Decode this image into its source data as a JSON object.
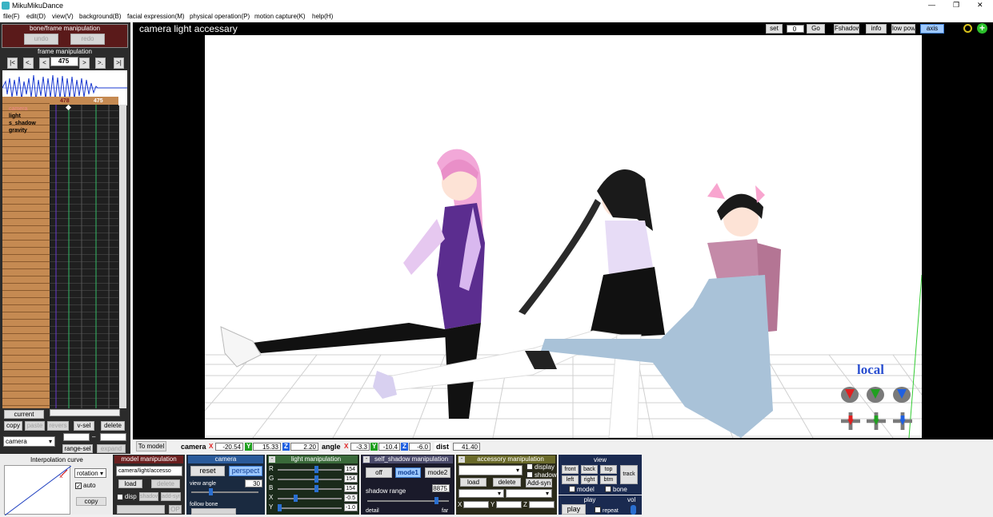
{
  "window": {
    "title": "MikuMikuDance",
    "minimize": "—",
    "restore": "❐",
    "close": "✕"
  },
  "menu": [
    "file(F)",
    "edit(D)",
    "view(V)",
    "background(B)",
    "facial expression(M)",
    "physical operation(P)",
    "motion capture(K)",
    "help(H)"
  ],
  "bone_frame": {
    "title": "bone/frame manipulation",
    "undo": "undo",
    "redo": "redo"
  },
  "frame_manip": {
    "title": "frame manipulation",
    "frame": "475",
    "nav": [
      "|<",
      "<.",
      "<",
      "> ",
      ">.",
      ">|"
    ]
  },
  "timeline": {
    "marker_a": "478",
    "marker_b": "475",
    "tracks": [
      "camera",
      "light",
      "s_shadow",
      "gravity"
    ]
  },
  "left_controls": {
    "current": "current",
    "copy": "copy",
    "paste": "paste",
    "revers": "revers",
    "v_sel": "v-sel",
    "delete": "delete",
    "range_sel": "range-sel",
    "expand": "expand",
    "target": "camera",
    "dash": "–"
  },
  "viewport": {
    "title": "camera light accessary",
    "set": "set",
    "set_value": "0",
    "go": "Go",
    "fshadow": "Fshadow",
    "info": "info",
    "lowpow": "low pow",
    "axis": "axis",
    "local": "local"
  },
  "status": {
    "to_model": "To model",
    "camera_label": "camera",
    "cx": "-20.54",
    "cy": "15.33",
    "cz": "2.20",
    "angle_label": "angle",
    "ax": "-3.3",
    "ay": "-10.4",
    "az": "-6.0",
    "dist_label": "dist",
    "dist": "41.40",
    "x": "X",
    "y": "Y",
    "z": "Z"
  },
  "interp": {
    "title": "Interpolation curve",
    "mode": "rotation",
    "auto": "auto",
    "copy": "copy"
  },
  "model_manip": {
    "title": "model manipulation",
    "target": "camera/light/accesso",
    "load": "load",
    "delete": "delete",
    "disp": "disp",
    "shadow": "shadow",
    "add_syn": "add-syn",
    "op": "OP"
  },
  "camera_panel": {
    "title": "camera",
    "reset": "reset",
    "perspect": "perspect",
    "view_angle_label": "view angle",
    "view_angle": "30",
    "follow_bone": "follow bone"
  },
  "light_panel": {
    "title": "light manipulation",
    "labels": [
      "R",
      "G",
      "B",
      "X",
      "Y"
    ],
    "values": [
      "154",
      "154",
      "154",
      "-0.5",
      "-1.0"
    ]
  },
  "shadow_panel": {
    "title": "self_shadow manipulation",
    "off": "off",
    "mode1": "mode1",
    "mode2": "mode2",
    "range_label": "shadow range",
    "range": "8875",
    "detail": "detail",
    "far": "far"
  },
  "accessory_panel": {
    "title": "accessory manipulation",
    "display": "display",
    "shadow": "shadow",
    "load": "load",
    "delete": "delete",
    "add_syn": "Add-syn",
    "x": "X",
    "y": "Y",
    "z": "Z"
  },
  "view_panel": {
    "title": "view",
    "front": "front",
    "back": "back",
    "top": "top",
    "left": "left",
    "right": "right",
    "btm": "btm",
    "track": "track",
    "model": "model",
    "bone": "bone"
  },
  "play_panel": {
    "title": "play",
    "play": "play",
    "repeat": "repeat",
    "vol": "vol"
  },
  "colors": {
    "accent": "#2a5a9a",
    "panel_dark": "#1a2a40",
    "header_red": "#6b1f1f",
    "axis_x": "#e02020",
    "axis_y": "#20a020",
    "axis_z": "#2060e0"
  }
}
